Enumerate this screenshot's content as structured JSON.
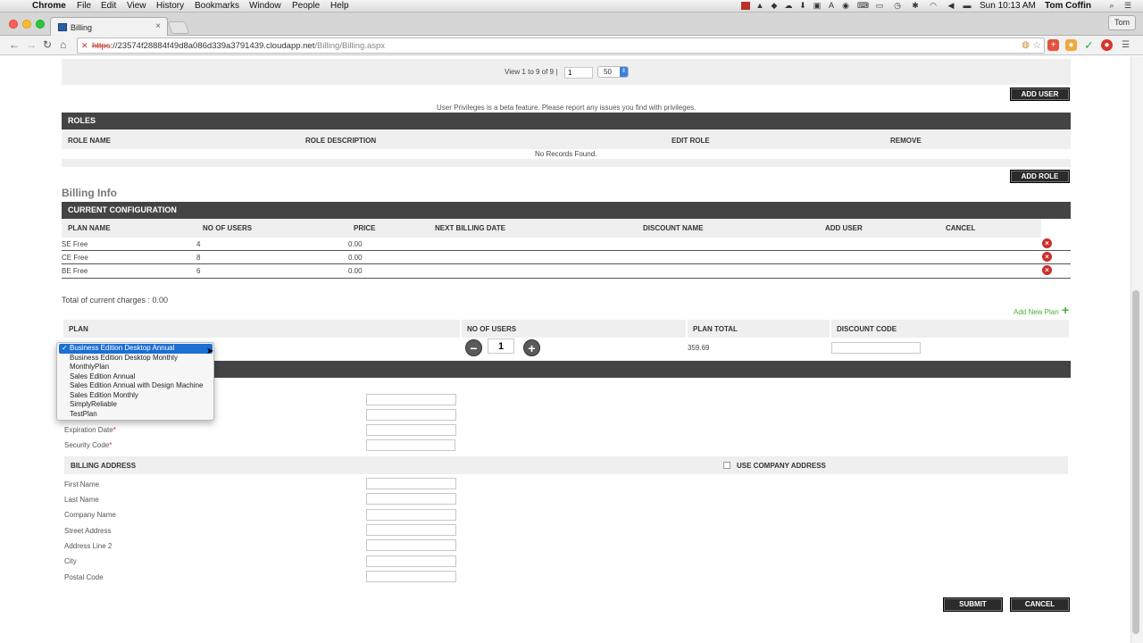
{
  "menubar": {
    "apple_glyph": "",
    "app_name": "Chrome",
    "items": [
      "File",
      "Edit",
      "View",
      "History",
      "Bookmarks",
      "Window",
      "People",
      "Help"
    ],
    "clock": "Sun 10:13 AM",
    "user": "Tom Coffin"
  },
  "browser": {
    "tab_title": "Billing",
    "tab_close": "×",
    "profile": "Tom",
    "url_scheme": "https",
    "url_host": "://23574f28884f49d8a086d339a3791439.cloudapp.net",
    "url_path": "/Billing/Billing.aspx"
  },
  "pager": {
    "view_text": "View 1 to 9 of 9 |",
    "page_value": "1",
    "page_size": "50"
  },
  "users": {
    "add_user_label": "ADD USER",
    "beta_notice": "User Privileges is a beta feature. Please report any issues you find with privileges."
  },
  "roles": {
    "title": "ROLES",
    "columns": [
      "ROLE NAME",
      "ROLE DESCRIPTION",
      "EDIT ROLE",
      "REMOVE"
    ],
    "empty_text": "No Records Found.",
    "add_role_label": "ADD ROLE"
  },
  "billing": {
    "heading": "Billing Info",
    "config_title": "CURRENT CONFIGURATION",
    "columns": [
      "PLAN NAME",
      "NO OF USERS",
      "PRICE",
      "NEXT BILLING DATE",
      "DISCOUNT NAME",
      "ADD USER",
      "CANCEL"
    ],
    "rows": [
      {
        "plan": "SE Free",
        "users": "4",
        "price": "0.00"
      },
      {
        "plan": "CE Free",
        "users": "8",
        "price": "0.00"
      },
      {
        "plan": "BE Free",
        "users": "6",
        "price": "0.00"
      }
    ],
    "total_text": "Total of current charges : 0.00",
    "add_plan_label": "Add New Plan",
    "add_plan_icon": "+"
  },
  "new_plan": {
    "columns": [
      "PLAN",
      "NO OF USERS",
      "PLAN TOTAL",
      "DISCOUNT CODE"
    ],
    "selected_plan": "Business Edition Desktop Annual",
    "options": [
      "Business Edition Desktop Annual",
      "Business Edition Desktop Monthly",
      "MonthlyPlan",
      "Sales Edition Annual",
      "Sales Edition Annual with Design Machine",
      "Sales Edition Monthly",
      "SimplyReliable",
      "TestPlan"
    ],
    "check_glyph": "✓",
    "users_value": "1",
    "minus_glyph": "−",
    "plus_glyph": "+",
    "plan_total": "359.69"
  },
  "card": {
    "expiration_label": "Expiration Date",
    "security_label": "Security Code",
    "required_mark": "*"
  },
  "billing_address": {
    "title": "BILLING ADDRESS",
    "use_company_label": "USE COMPANY ADDRESS",
    "fields": [
      "First Name",
      "Last Name",
      "Company Name",
      "Street Address",
      "Address Line 2",
      "City",
      "Postal Code"
    ]
  },
  "actions": {
    "submit_label": "SUBMIT",
    "cancel_label": "CANCEL"
  },
  "colors": {
    "dark_header": "#444444",
    "row_grey": "#efefef",
    "danger": "#c9302c",
    "select_blue": "#1c6fd3",
    "add_green": "#4caf32"
  }
}
